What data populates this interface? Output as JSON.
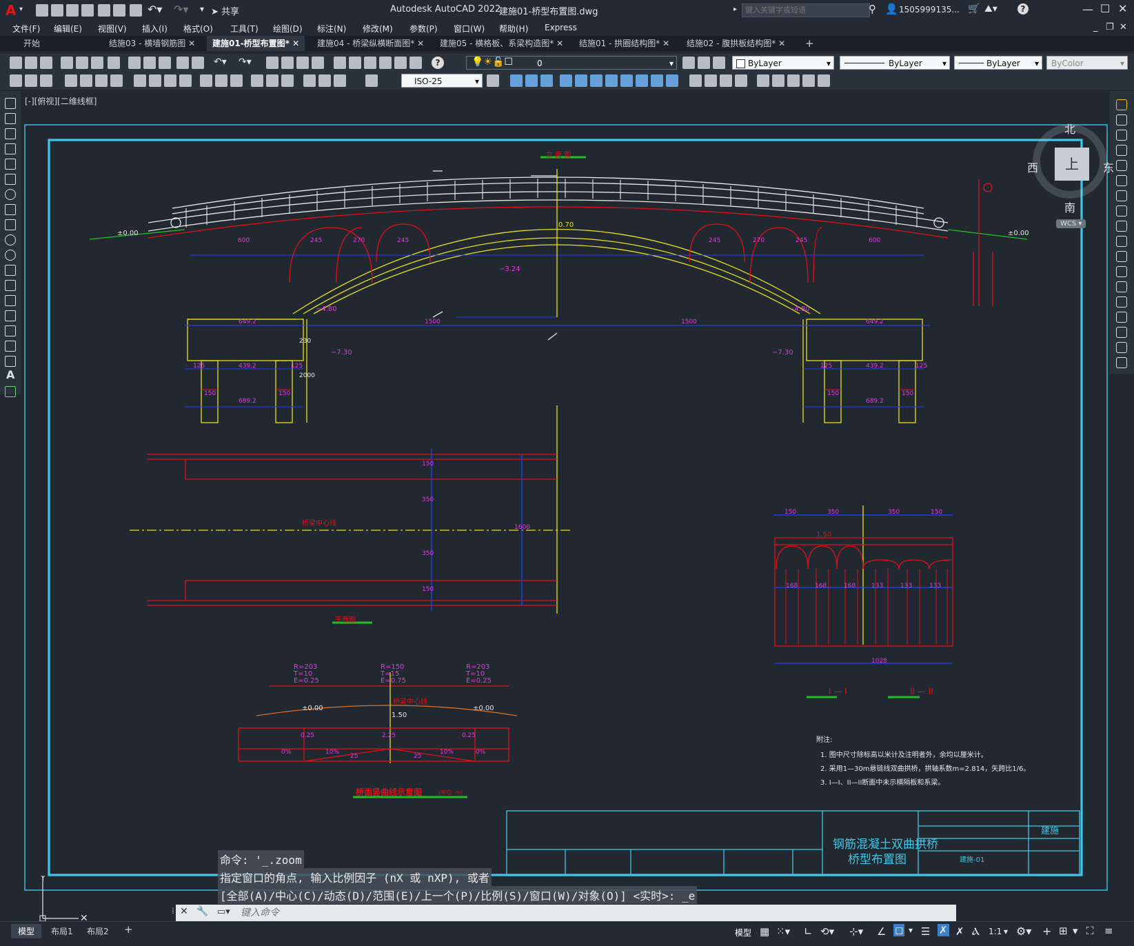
{
  "app": {
    "logo": "A",
    "title": "Autodesk AutoCAD 2022",
    "filename": "建施01-桥型布置图.dwg",
    "share": "共享"
  },
  "search": {
    "placeholder": "键入关键字或短语"
  },
  "user": {
    "name": "1505999135..."
  },
  "menu": [
    "文件(F)",
    "编辑(E)",
    "视图(V)",
    "插入(I)",
    "格式(O)",
    "工具(T)",
    "绘图(D)",
    "标注(N)",
    "修改(M)",
    "参数(P)",
    "窗口(W)",
    "帮助(H)",
    "Express"
  ],
  "tabs": [
    {
      "label": "开始"
    },
    {
      "label": "结施03 - 横墙钢筋图"
    },
    {
      "label": "建施01-桥型布置图*"
    },
    {
      "label": "建施04 - 桥梁纵横断面图*"
    },
    {
      "label": "建施05 - 横格板、系梁构造图*"
    },
    {
      "label": "结施01 - 拱圈结构图*"
    },
    {
      "label": "结施02 - 腹拱板结构图*"
    }
  ],
  "layer": {
    "current": "0"
  },
  "props": {
    "color": "ByLayer",
    "linetype": "ByLayer",
    "lineweight": "ByLayer",
    "plotstyle": "ByColor"
  },
  "dimstyle": "ISO-25",
  "view_label": "[-][俯视][二维线框]",
  "viewcube": {
    "north": "北",
    "south": "南",
    "east": "东",
    "west": "西",
    "top": "上",
    "wcs": "WCS"
  },
  "drawing": {
    "elevation_title": "立 面 图",
    "plan_title": "平面图",
    "curve_title": "桥面竖曲线示意图",
    "curve_unit": "(单位: m)",
    "section1": "I — I",
    "section2": "II — II",
    "notes_title": "附注:",
    "notes": [
      "1.  图中尺寸除标高以米计及注明者外，余均以厘米计。",
      "2.  采用1—30m悬链线双曲拱桥，拱轴系数m=2.814，矢跨比1/6。",
      "3.  I—I、II—II断面中未示横隔板和系梁。"
    ],
    "title_block": {
      "name_line1": "钢筋混凝土双曲拱桥",
      "name_line2": "桥型布置图",
      "stage": "建施",
      "drawing_no": "建施-01"
    },
    "dims": {
      "d600": "600",
      "d245": "245",
      "d270": "270",
      "d1500": "1500",
      "d649": "649.2",
      "d439": "439.2",
      "d689": "689.2",
      "d125": "125",
      "d150": "150",
      "d230": "230",
      "d2000": "2000",
      "d1028": "1028",
      "d168": "168",
      "d133": "133",
      "d350": "350",
      "d1600": "1600",
      "e000": "±0.00",
      "e070": "0.70",
      "e324": "−3.24",
      "e480": "−4.80",
      "e730": "−7.30",
      "e150": "1.50"
    },
    "curve": {
      "r1": "R=203",
      "t1": "T=10",
      "e1": "E=0.25",
      "r2": "R=150",
      "t2": "T=15",
      "e2": "E=0.75",
      "center": "桥梁中心线",
      "p0": "0%",
      "p10": "10%",
      "v25": "25",
      "h025": "0.25",
      "h225": "2.25"
    },
    "plan_center": "桥梁中心线"
  },
  "command": {
    "line1": "命令: '_.zoom",
    "line2": "指定窗口的角点, 输入比例因子 (nX 或 nXP), 或者",
    "line3": "[全部(A)/中心(C)/动态(D)/范围(E)/上一个(P)/比例(S)/窗口(W)/对象(O)] <实时>: _e",
    "placeholder": "键入命令"
  },
  "layout_tabs": [
    "模型",
    "布局1",
    "布局2"
  ],
  "status": {
    "model": "模型",
    "scale": "1:1"
  },
  "colors": {
    "cyan": "#3fc7e8",
    "red": "#e0101a",
    "yellow": "#e8e01a",
    "magenta": "#e03ce0",
    "white": "#e8e8e8",
    "green": "#20c020",
    "blue": "#2040ff"
  }
}
